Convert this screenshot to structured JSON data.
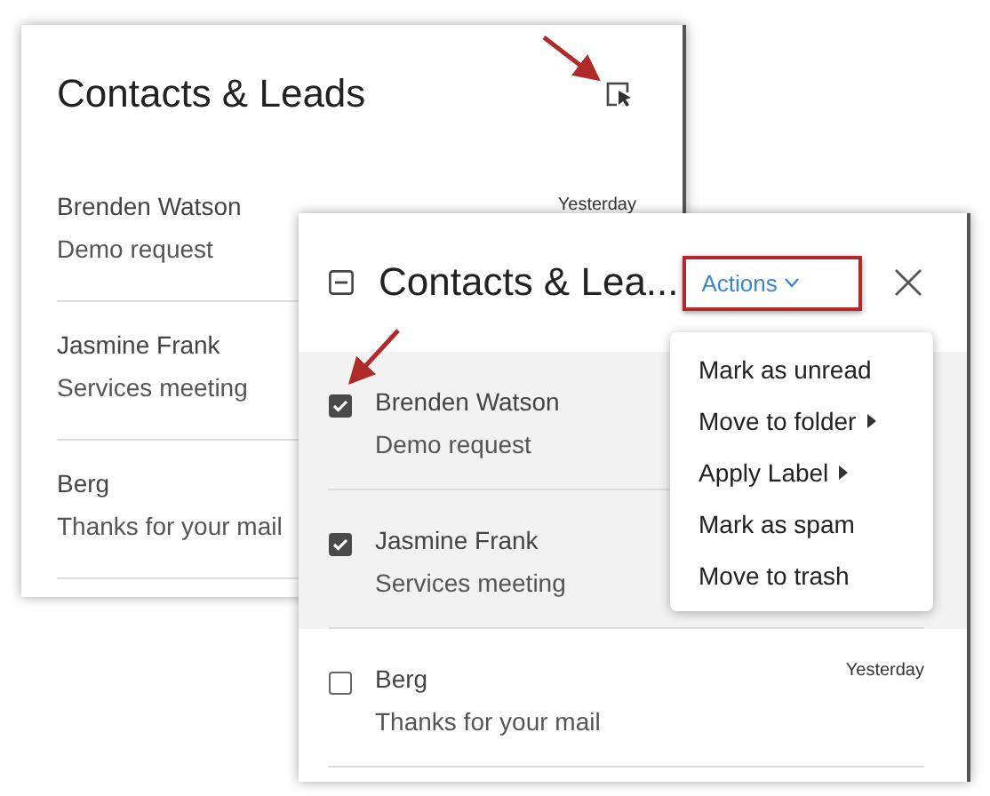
{
  "back_panel": {
    "title": "Contacts & Leads",
    "messages": [
      {
        "sender": "Brenden Watson",
        "subject": "Demo request",
        "date": "Yesterday"
      },
      {
        "sender": "Jasmine Frank",
        "subject": "Services meeting"
      },
      {
        "sender": "Berg",
        "subject": "Thanks for your mail"
      }
    ]
  },
  "front_panel": {
    "title": "Contacts & Lea...",
    "actions_button": "Actions",
    "messages": [
      {
        "sender": "Brenden Watson",
        "subject": "Demo request",
        "checked": true
      },
      {
        "sender": "Jasmine Frank",
        "subject": "Services meeting",
        "checked": true
      },
      {
        "sender": "Berg",
        "subject": "Thanks for your mail",
        "checked": false,
        "date": "Yesterday"
      }
    ],
    "actions_menu": [
      {
        "label": "Mark as unread",
        "submenu": false
      },
      {
        "label": "Move to folder",
        "submenu": true
      },
      {
        "label": "Apply Label",
        "submenu": true
      },
      {
        "label": "Mark as spam",
        "submenu": false
      },
      {
        "label": "Move to trash",
        "submenu": false
      }
    ]
  }
}
